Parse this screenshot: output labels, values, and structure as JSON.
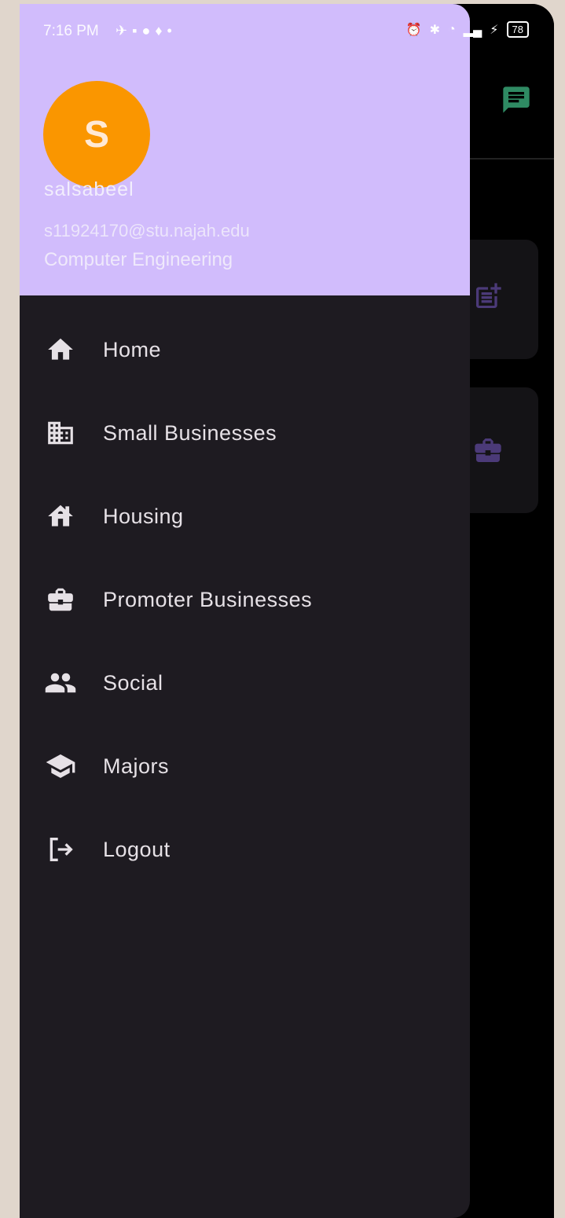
{
  "status_bar": {
    "time": "7:16 PM",
    "battery": "78"
  },
  "drawer": {
    "avatar_letter": "S",
    "user_name": "salsabeel",
    "user_email": "s11924170@stu.najah.edu",
    "user_major": "Computer Engineering",
    "items": [
      {
        "label": "Home",
        "icon": "home-icon"
      },
      {
        "label": "Small Businesses",
        "icon": "business-building-icon"
      },
      {
        "label": "Housing",
        "icon": "housing-icon"
      },
      {
        "label": "Promoter Businesses",
        "icon": "briefcase-icon"
      },
      {
        "label": "Social",
        "icon": "people-icon"
      },
      {
        "label": "Majors",
        "icon": "graduation-cap-icon"
      },
      {
        "label": "Logout",
        "icon": "logout-icon"
      }
    ]
  },
  "colors": {
    "header_bg": "#d1bcfc",
    "drawer_bg": "#1e1b21",
    "avatar_bg": "#fa9600",
    "chat_icon": "#2f8a63"
  }
}
